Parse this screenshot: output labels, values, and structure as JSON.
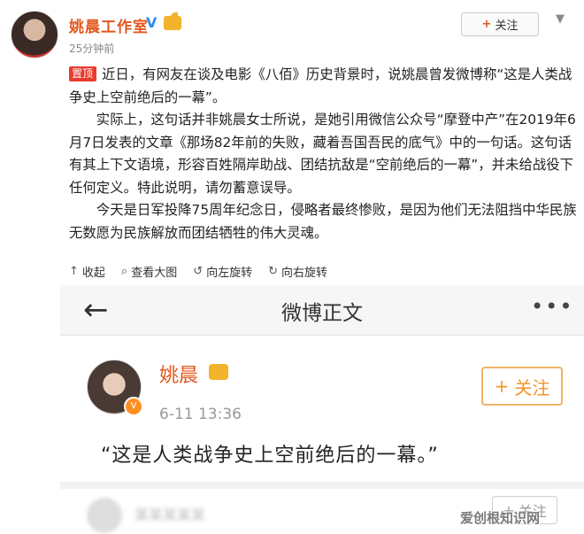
{
  "post": {
    "author": "姚晨工作室",
    "verified_mark": "V",
    "time": "25分钟前",
    "follow_plus": "+",
    "follow_label": "关注",
    "pin_label": "置顶",
    "para1": "近日，有网友在谈及电影《八佰》历史背景时，说姚晨曾发微博称“这是人类战争史上空前绝后的一幕”。",
    "para2": "实际上，这句话并非姚晨女士所说，是她引用微信公众号“摩登中产”在2019年6月7日发表的文章《那场82年前的失败，藏着吾国吾民的底气》中的一句话。这句话有其上下文语境，形容百姓隔岸助战、团结抗敌是“空前绝后的一幕”，并未给战役下任何定义。特此说明，请勿蓄意误导。",
    "para3": "今天是日军投降75周年纪念日，侵略者最终惨败，是因为他们无法阻挡中华民族无数愿为民族解放而团结牺牲的伟大灵魂。"
  },
  "image_toolbar": {
    "collapse": "收起",
    "view_large": "查看大图",
    "rotate_left": "向左旋转",
    "rotate_right": "向右旋转"
  },
  "screenshot": {
    "nav_title": "微博正文",
    "more": "•••",
    "author": "姚晨",
    "time": "6-11 13:36",
    "follow_plus": "+",
    "follow_label": "关注",
    "quote": "“这是人类战争史上空前绝后的一幕。”",
    "next_follow_plus": "+",
    "next_follow_label": "关注",
    "next_name_blurred": "某某某某某"
  },
  "watermark": "爱创根知识网",
  "colors": {
    "author_orange": "#e2571f",
    "pin_red": "#e83a2e",
    "follow_gold": "#f0952a"
  }
}
